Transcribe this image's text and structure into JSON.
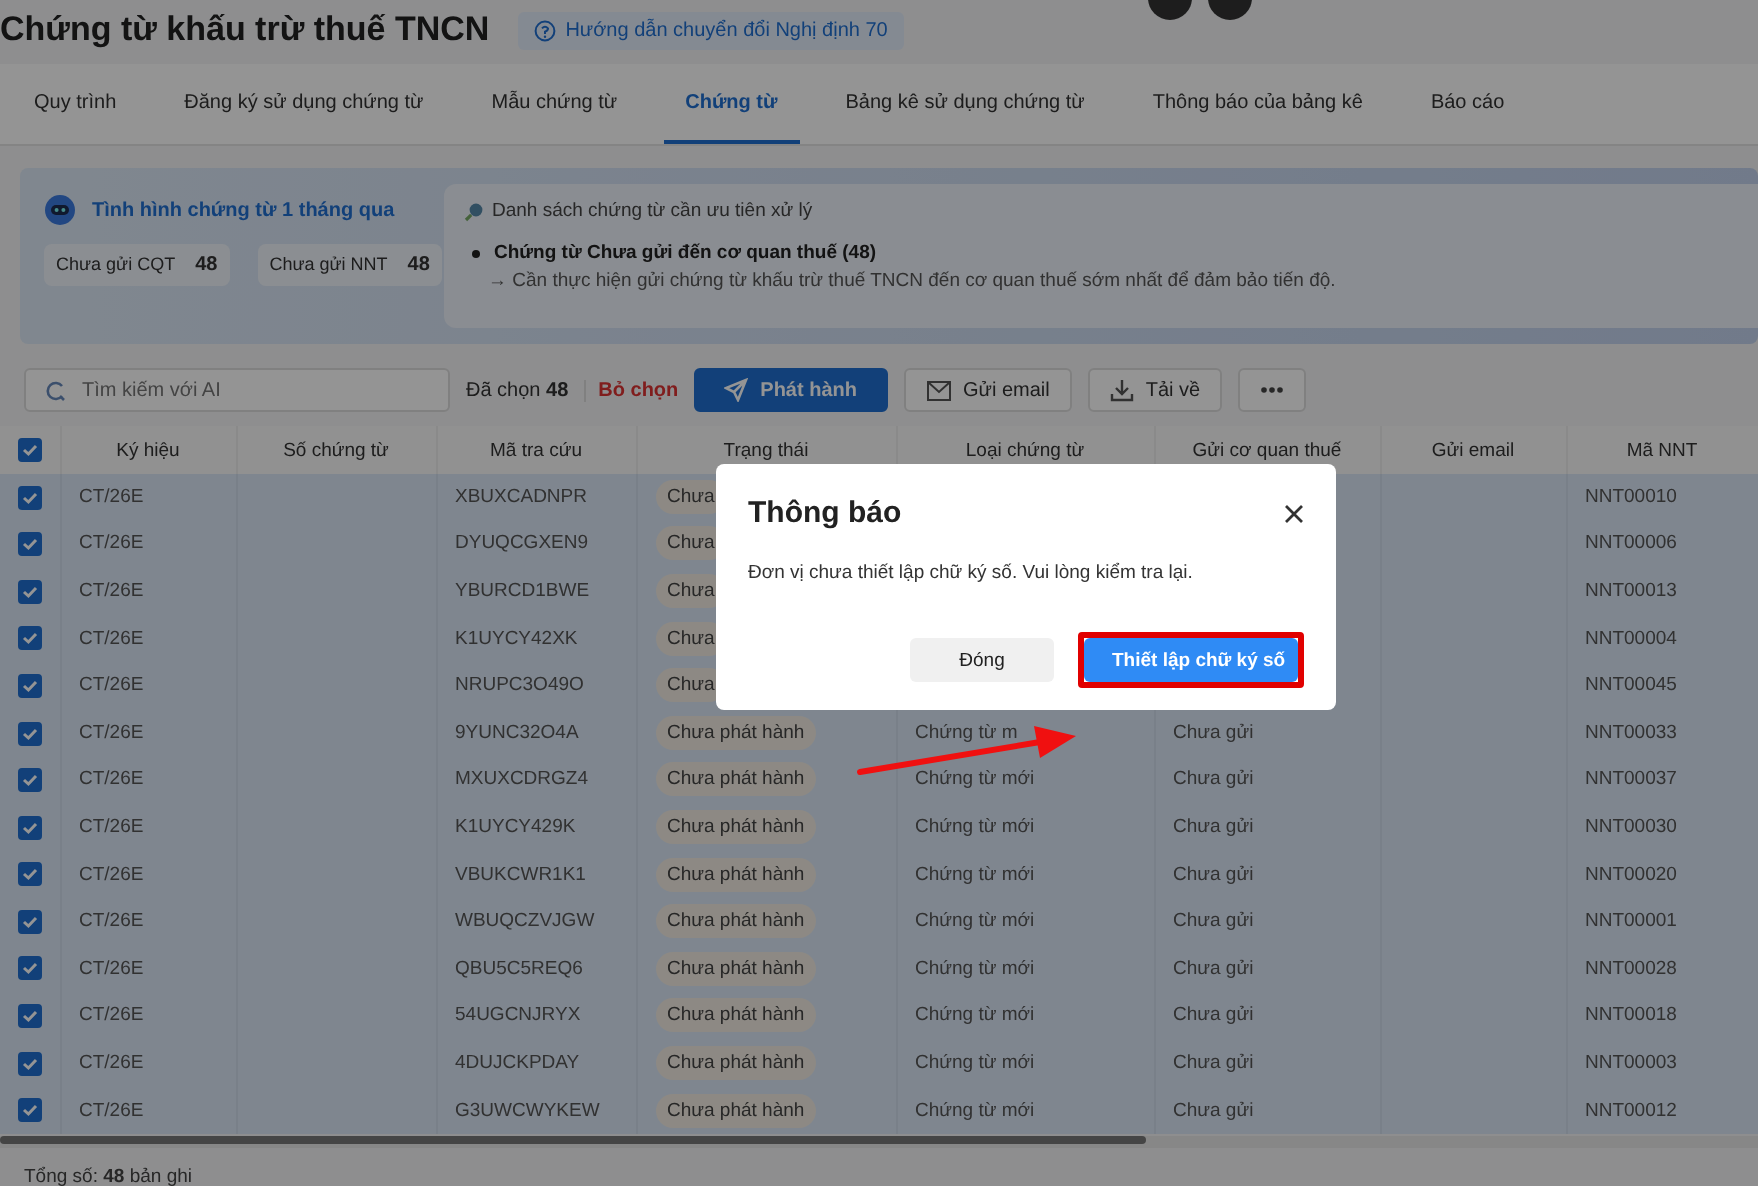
{
  "header": {
    "title": "Chứng từ khấu trừ thuế TNCN",
    "guide_link": "Hướng dẫn chuyển đổi Nghị định 70"
  },
  "tabs": [
    {
      "label": "Quy trình",
      "selected": false
    },
    {
      "label": "Đăng ký sử dụng chứng từ",
      "selected": false
    },
    {
      "label": "Mẫu chứng từ",
      "selected": false
    },
    {
      "label": "Chứng từ",
      "selected": true
    },
    {
      "label": "Bảng kê sử dụng chứng từ",
      "selected": false
    },
    {
      "label": "Thông báo của bảng kê",
      "selected": false
    },
    {
      "label": "Báo cáo",
      "selected": false
    }
  ],
  "summary": {
    "title": "Tình hình chứng từ 1 tháng qua",
    "stats": [
      {
        "label": "Chưa gửi CQT",
        "value": "48"
      },
      {
        "label": "Chưa gửi NNT",
        "value": "48"
      }
    ],
    "priority": {
      "heading": "Danh sách chứng từ cần ưu tiên xử lý",
      "item_title": "Chứng từ Chưa gửi đến cơ quan thuế (48)",
      "item_detail": "→ Cần thực hiện gửi chứng từ khấu trừ thuế TNCN đến cơ quan thuế sớm nhất để đảm bảo tiến độ."
    }
  },
  "toolbar": {
    "search_placeholder": "Tìm kiếm với AI",
    "selected_label": "Đã chọn",
    "selected_count": "48",
    "clear": "Bỏ chọn",
    "buttons": [
      {
        "kind": "primary",
        "label": "Phát hành"
      },
      {
        "kind": "email",
        "label": "Gửi email"
      },
      {
        "kind": "download",
        "label": "Tải về"
      },
      {
        "kind": "more"
      }
    ]
  },
  "table": {
    "all_checked": true,
    "columns": [
      "Ký hiệu",
      "Số chứng từ",
      "Mã tra cứu",
      "Trạng thái",
      "Loại chứng từ",
      "Gửi cơ quan thuế",
      "Gửi email",
      "Mã NNT"
    ],
    "rows": [
      {
        "checked": true,
        "symbol": "CT/26E",
        "lookup": "XBUXCADNPR",
        "status": "Chưa",
        "tax_id": "NNT00010"
      },
      {
        "checked": true,
        "symbol": "CT/26E",
        "lookup": "DYUQCGXEN9",
        "status": "Chưa",
        "tax_id": "NNT00006"
      },
      {
        "checked": true,
        "symbol": "CT/26E",
        "lookup": "YBURCD1BWE",
        "status": "Chưa",
        "tax_id": "NNT00013"
      },
      {
        "checked": true,
        "symbol": "CT/26E",
        "lookup": "K1UYCY42XK",
        "status": "Chưa",
        "tax_id": "NNT00004"
      },
      {
        "checked": true,
        "symbol": "CT/26E",
        "lookup": "NRUPC3O49O",
        "status": "Chưa",
        "tax_id": "NNT00045"
      },
      {
        "checked": true,
        "symbol": "CT/26E",
        "lookup": "9YUNC32O4A",
        "status": "Chưa phát hành",
        "type": "Chứng từ m",
        "tax_send": "Chưa gửi",
        "tax_id": "NNT00033"
      },
      {
        "checked": true,
        "symbol": "CT/26E",
        "lookup": "MXUXCDRGZ4",
        "status": "Chưa phát hành",
        "type": "Chứng từ mới",
        "tax_send": "Chưa gửi",
        "tax_id": "NNT00037"
      },
      {
        "checked": true,
        "symbol": "CT/26E",
        "lookup": "K1UYCY429K",
        "status": "Chưa phát hành",
        "type": "Chứng từ mới",
        "tax_send": "Chưa gửi",
        "tax_id": "NNT00030"
      },
      {
        "checked": true,
        "symbol": "CT/26E",
        "lookup": "VBUKCWR1K1",
        "status": "Chưa phát hành",
        "type": "Chứng từ mới",
        "tax_send": "Chưa gửi",
        "tax_id": "NNT00020"
      },
      {
        "checked": true,
        "symbol": "CT/26E",
        "lookup": "WBUQCZVJGW",
        "status": "Chưa phát hành",
        "type": "Chứng từ mới",
        "tax_send": "Chưa gửi",
        "tax_id": "NNT00001"
      },
      {
        "checked": true,
        "symbol": "CT/26E",
        "lookup": "QBU5C5REQ6",
        "status": "Chưa phát hành",
        "type": "Chứng từ mới",
        "tax_send": "Chưa gửi",
        "tax_id": "NNT00028"
      },
      {
        "checked": true,
        "symbol": "CT/26E",
        "lookup": "54UGCNJRYX",
        "status": "Chưa phát hành",
        "type": "Chứng từ mới",
        "tax_send": "Chưa gửi",
        "tax_id": "NNT00018"
      },
      {
        "checked": true,
        "symbol": "CT/26E",
        "lookup": "4DUJCKPDAY",
        "status": "Chưa phát hành",
        "type": "Chứng từ mới",
        "tax_send": "Chưa gửi",
        "tax_id": "NNT00003"
      },
      {
        "checked": true,
        "symbol": "CT/26E",
        "lookup": "G3UWCWYKEW",
        "status": "Chưa phát hành",
        "type": "Chứng từ mới",
        "tax_send": "Chưa gửi",
        "tax_id": "NNT00012"
      }
    ]
  },
  "footer": {
    "total": "Tổng số: **48** bản ghi"
  },
  "dialog": {
    "title": "Thông báo",
    "message": "Đơn vị chưa thiết lập chữ ký số. Vui lòng kiểm tra lại.",
    "buttons": [
      {
        "kind": "secondary",
        "label": "Đóng",
        "highlighted": false
      },
      {
        "kind": "primary",
        "label": "Thiết lập chữ ký số",
        "highlighted": true
      }
    ]
  }
}
